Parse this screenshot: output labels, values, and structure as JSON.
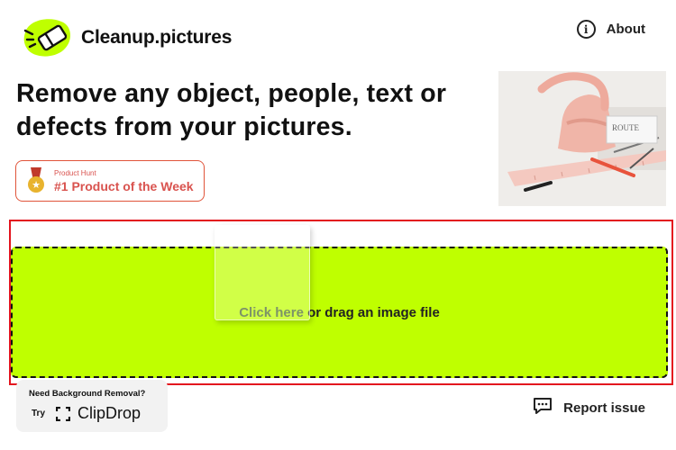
{
  "header": {
    "logo_text": "Cleanup.pictures",
    "about_label": "About"
  },
  "hero": {
    "headline": "Remove any object, people, text or defects from your pictures.",
    "image_alt": "Pink handbag with ruler and pens"
  },
  "badge": {
    "small": "Product Hunt",
    "big": "#1 Product of the Week"
  },
  "upload": {
    "link_text": "Click here",
    "rest_text": " or drag an image file"
  },
  "promo": {
    "question": "Need Background Removal?",
    "try_label": "Try",
    "brand": "ClipDrop"
  },
  "footer": {
    "report_label": "Report issue"
  },
  "colors": {
    "accent": "#bfff00",
    "badge": "#d9534f",
    "highlight_outline": "#e3141e"
  },
  "icons": {
    "logo": "eraser-logo-icon",
    "about": "info-icon",
    "badge": "medal-icon",
    "clipdrop": "clipdrop-icon",
    "report": "chat-bubble-icon"
  }
}
